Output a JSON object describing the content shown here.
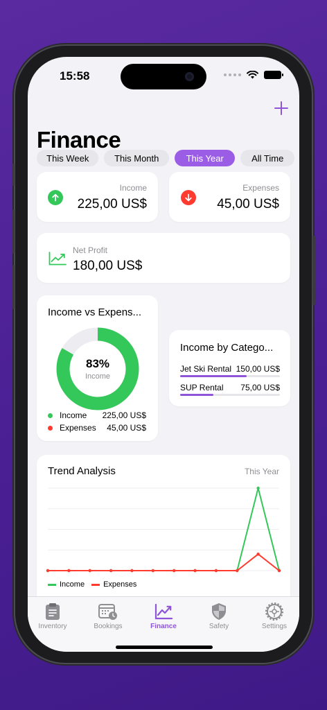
{
  "status": {
    "time": "15:58"
  },
  "header": {
    "title": "Finance",
    "add_icon": "plus-icon"
  },
  "segments": [
    {
      "label": "This Week",
      "active": false
    },
    {
      "label": "This Month",
      "active": false
    },
    {
      "label": "This Year",
      "active": true
    },
    {
      "label": "All Time",
      "active": false
    }
  ],
  "summary": {
    "income": {
      "label": "Income",
      "value": "225,00 US$",
      "icon": "arrow-up-circle-icon",
      "color": "#34c759"
    },
    "expenses": {
      "label": "Expenses",
      "value": "45,00 US$",
      "icon": "arrow-down-circle-icon",
      "color": "#ff3b30"
    },
    "net_profit": {
      "label": "Net Profit",
      "value": "180,00 US$",
      "icon": "trend-chart-icon",
      "color": "#34c759"
    }
  },
  "income_vs_expenses": {
    "title": "Income vs Expens...",
    "percent": "83%",
    "percent_sub": "Income",
    "income_fraction": 0.833,
    "legend": [
      {
        "label": "Income",
        "value": "225,00 US$",
        "color": "#34c759"
      },
      {
        "label": "Expenses",
        "value": "45,00 US$",
        "color": "#ff3b30"
      }
    ]
  },
  "income_by_category": {
    "title": "Income by Catego...",
    "items": [
      {
        "label": "Jet Ski Rental",
        "value": "150,00 US$",
        "fraction": 0.667
      },
      {
        "label": "SUP Rental",
        "value": "75,00 US$",
        "fraction": 0.333
      }
    ]
  },
  "trend": {
    "title": "Trend Analysis",
    "period": "This Year",
    "legend": [
      {
        "label": "Income",
        "color": "#34c759"
      },
      {
        "label": "Expenses",
        "color": "#ff3b30"
      }
    ]
  },
  "chart_data": {
    "type": "line",
    "x": [
      1,
      2,
      3,
      4,
      5,
      6,
      7,
      8,
      9,
      10,
      11,
      12
    ],
    "series": [
      {
        "name": "Income",
        "values": [
          0,
          0,
          0,
          0,
          0,
          0,
          0,
          0,
          0,
          0,
          225,
          0
        ],
        "color": "#34c759"
      },
      {
        "name": "Expenses",
        "values": [
          0,
          0,
          0,
          0,
          0,
          0,
          0,
          0,
          0,
          0,
          45,
          0
        ],
        "color": "#ff3b30"
      }
    ],
    "ylim": [
      0,
      225
    ],
    "grid": true,
    "legend": "bottom-left"
  },
  "tabs": [
    {
      "label": "Inventory",
      "icon": "clipboard-icon",
      "active": false
    },
    {
      "label": "Bookings",
      "icon": "calendar-clock-icon",
      "active": false
    },
    {
      "label": "Finance",
      "icon": "chart-line-icon",
      "active": true
    },
    {
      "label": "Safety",
      "icon": "shield-icon",
      "active": false
    },
    {
      "label": "Settings",
      "icon": "gear-icon",
      "active": false
    }
  ]
}
